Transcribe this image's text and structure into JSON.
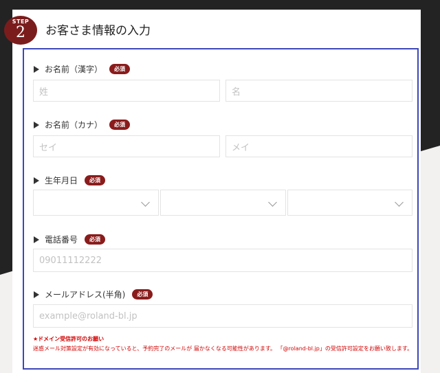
{
  "step": {
    "word": "STEP",
    "number": "2"
  },
  "title": "お客さま情報の入力",
  "required_badge": "必須",
  "fields": {
    "name_kanji": {
      "label": "お名前（漢字）",
      "last_placeholder": "姓",
      "first_placeholder": "名"
    },
    "name_kana": {
      "label": "お名前（カナ）",
      "last_placeholder": "セイ",
      "first_placeholder": "メイ"
    },
    "birthday": {
      "label": "生年月日"
    },
    "phone": {
      "label": "電話番号",
      "placeholder": "09011112222"
    },
    "email": {
      "label": "メールアドレス(半角)",
      "placeholder": "example@roland-bl.jp"
    }
  },
  "notice": {
    "title": "★ドメイン受信許可のお願い",
    "body": "迷惑メール対策設定が有効になっていると、予約完了のメールが 届かなくなる可能性があります。 「@roland-bl.jp」の受信許可設定をお願い致します。"
  },
  "colors": {
    "accent": "#7b1c1c",
    "frame": "#3c47b7",
    "notice": "#d10000"
  }
}
